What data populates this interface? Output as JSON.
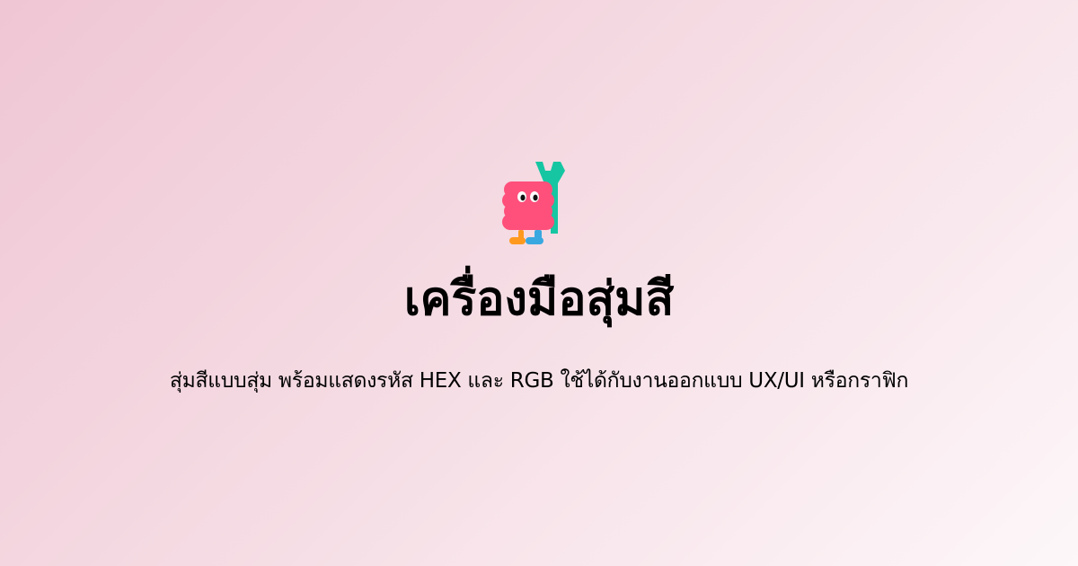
{
  "page": {
    "title": "เครื่องมือสุ่มสี",
    "subtitle": "สุ่มสีแบบสุ่ม พร้อมแสดงรหัส HEX และ RGB ใช้ได้กับงานออกแบบ UX/UI หรือกราฟิก"
  },
  "mascot": {
    "icon": "pink-monster-wrench-icon",
    "colors": {
      "body": "#ff4f7b",
      "wrench": "#16c6a2",
      "foot_left": "#ff9a1f",
      "foot_right": "#3aa8e0",
      "eye": "#111111"
    }
  },
  "theme": {
    "background_start": "#efc6d4",
    "background_end": "#fdf7f9"
  }
}
